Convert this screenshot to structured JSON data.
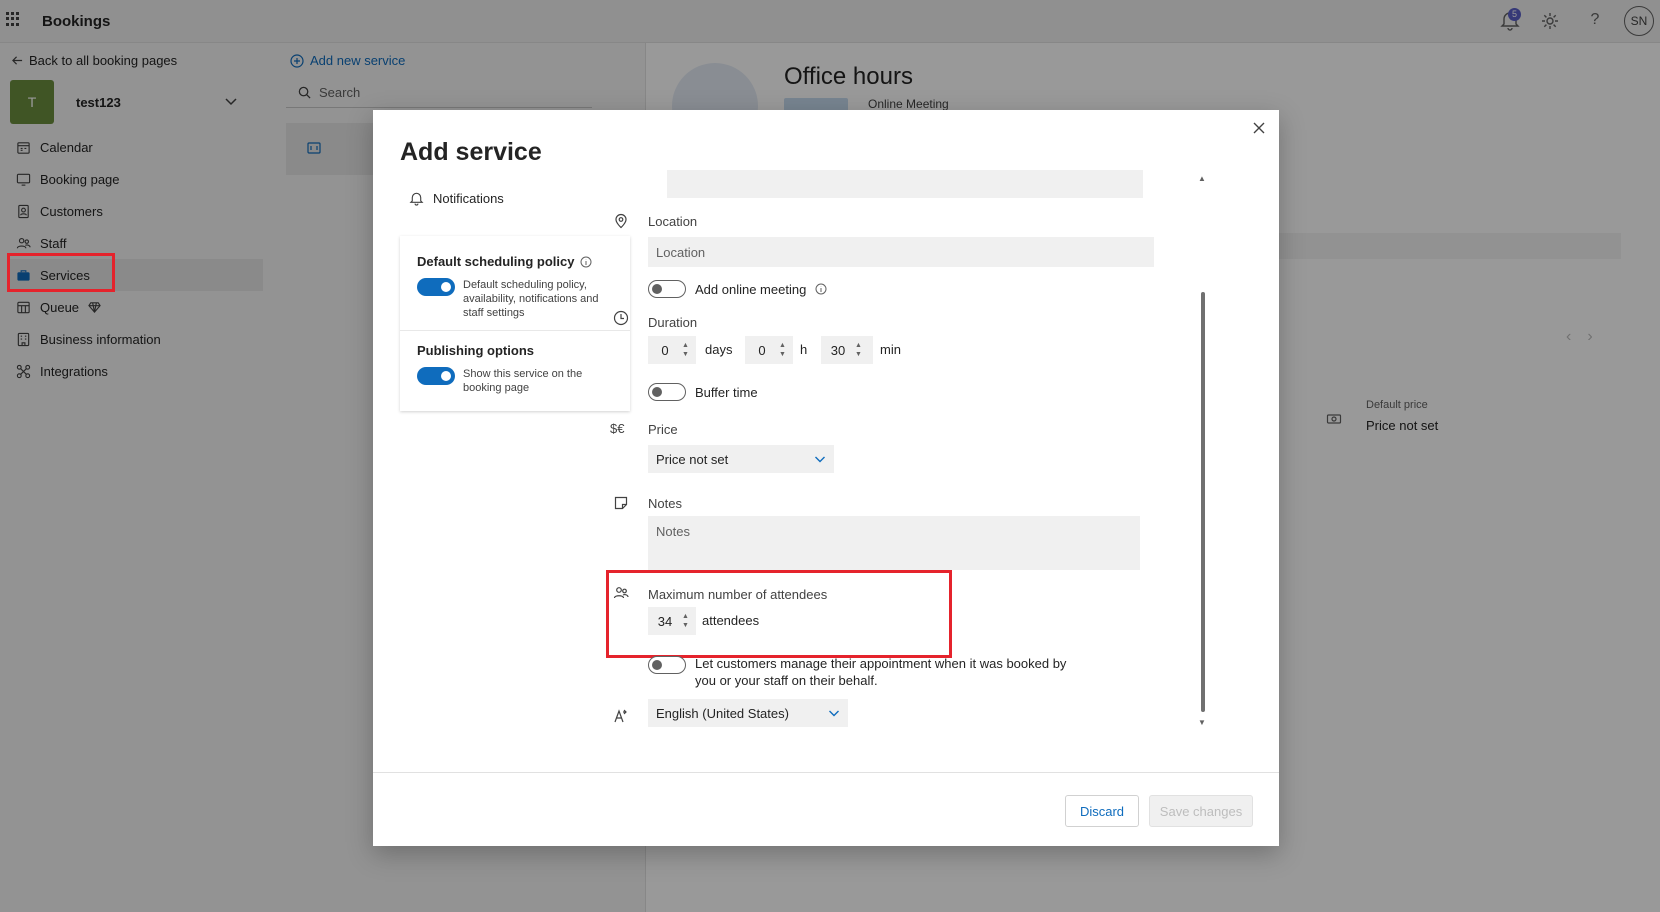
{
  "topbar": {
    "app_title": "Bookings",
    "notification_count": "5",
    "avatar_initials": "SN",
    "icons": [
      "app-launcher-icon",
      "notifications-icon",
      "settings-icon",
      "help-icon"
    ]
  },
  "leftnav": {
    "back_link": "Back to all booking pages",
    "page_avatar": "T",
    "page_name": "test123",
    "items": [
      {
        "label": "Calendar",
        "icon": "calendar-icon"
      },
      {
        "label": "Booking page",
        "icon": "monitor-icon"
      },
      {
        "label": "Customers",
        "icon": "contact-card-icon"
      },
      {
        "label": "Staff",
        "icon": "people-icon"
      },
      {
        "label": "Services",
        "icon": "briefcase-icon",
        "active": true
      },
      {
        "label": "Queue",
        "icon": "queue-icon"
      },
      {
        "label": "Business information",
        "icon": "building-icon"
      },
      {
        "label": "Integrations",
        "icon": "integrations-icon"
      }
    ],
    "highlight_color": "#e5232c"
  },
  "midcol": {
    "add_new": "Add new service",
    "search_placeholder": "Search"
  },
  "detail": {
    "title": "Office hours",
    "subtitle": "Online Meeting",
    "default_price_label": "Default price",
    "default_price_value": "Price not set"
  },
  "dialog": {
    "title": "Add service",
    "notifications": "Notifications",
    "side_cards": [
      {
        "title": "Default scheduling policy",
        "text": "Default scheduling policy, availability, notifications and staff settings",
        "toggle": true
      },
      {
        "title": "Publishing options",
        "text": "Show this service on the booking page",
        "toggle": true
      }
    ],
    "location": {
      "label": "Location",
      "placeholder": "Location"
    },
    "online_meeting": {
      "label": "Add online meeting",
      "toggle": false
    },
    "duration": {
      "label": "Duration",
      "days": "0",
      "days_unit": "days",
      "hours": "0",
      "hours_unit": "h",
      "minutes": "30",
      "minutes_unit": "min"
    },
    "buffer": {
      "label": "Buffer time",
      "toggle": false
    },
    "price": {
      "label": "Price",
      "selected": "Price not set"
    },
    "notes": {
      "label": "Notes",
      "placeholder": "Notes"
    },
    "attendees": {
      "label": "Maximum number of attendees",
      "value": "34",
      "unit": "attendees"
    },
    "manage": {
      "text_line1": "Let customers manage their appointment when it was booked by",
      "text_line2": "you or your staff on their behalf.",
      "toggle": false
    },
    "language": {
      "selected": "English (United States)"
    },
    "buttons": {
      "discard": "Discard",
      "save": "Save changes"
    }
  },
  "colors": {
    "accent": "#0f6cbd",
    "highlight": "#e5232c"
  }
}
